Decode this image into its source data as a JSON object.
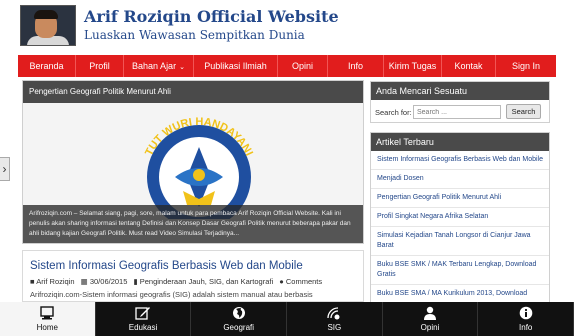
{
  "header": {
    "title": "Arif Roziqin Official Website",
    "tagline": "Luaskan Wawasan Sempitkan Dunia"
  },
  "nav": {
    "items": [
      {
        "label": "Beranda"
      },
      {
        "label": "Profil"
      },
      {
        "label": "Bahan Ajar",
        "has_dropdown": true
      },
      {
        "label": "Publikasi Ilmiah"
      },
      {
        "label": "Opini"
      },
      {
        "label": "Info"
      },
      {
        "label": "Kirim Tugas"
      },
      {
        "label": "Kontak"
      },
      {
        "label": "Sign In"
      }
    ],
    "accent_color": "#e11d1d"
  },
  "slider": {
    "title": "Pengertian Geografi Politik Menurut Ahli",
    "logo_text": "TUT WURI HANDAYANI",
    "caption": "Arifroziqin.com – Selamat siang, pagi, sore, malam untuk para pembaca Arif Roziqin Official Website. Kali ini penulis akan sharing informasi tentang Definisi dan Konsep Dasar Geografi Politik menurut beberapa pakar dan ahli bidang kajian Geografi Politik. Must read Video Simulasi Terjadinya..."
  },
  "post": {
    "title": "Sistem Informasi Geografis Berbasis Web dan Mobile",
    "author": "Arif Roziqin",
    "date": "30/06/2015",
    "categories": "Penginderaan Jauh, SIG, dan Kartografi",
    "comments": "Comments",
    "excerpt": "Arifroziqin.com-Sistem informasi geografis (SIG) adalah sistem manual atau berbasis"
  },
  "search_widget": {
    "title": "Anda Mencari Sesuatu",
    "label": "Search for:",
    "placeholder": "Search ...",
    "button": "Search"
  },
  "recent_posts": {
    "title": "Artikel Terbaru",
    "items": [
      "Sistem Informasi Geografis Berbasis Web dan Mobile",
      "Menjadi Dosen",
      "Pengertian Geografi Politik Menurut Ahli",
      "Profil Singkat Negara Afrika Selatan",
      "Simulasi Kejadian Tanah Longsor di Cianjur Jawa Barat",
      "Buku BSE SMK / MAK Terbaru Lengkap, Download Gratis",
      "Buku BSE SMA / MA Kurikulum 2013, Download"
    ]
  },
  "bottom_bar": {
    "items": [
      {
        "label": "Home",
        "icon": "home-icon",
        "active": true
      },
      {
        "label": "Edukasi",
        "icon": "edit-icon"
      },
      {
        "label": "Geografi",
        "icon": "globe-icon"
      },
      {
        "label": "SIG",
        "icon": "satellite-icon"
      },
      {
        "label": "Opini",
        "icon": "user-icon"
      },
      {
        "label": "Info",
        "icon": "info-icon"
      }
    ]
  },
  "left_tab": {
    "icon": "chevron-right-icon",
    "glyph": "›"
  }
}
